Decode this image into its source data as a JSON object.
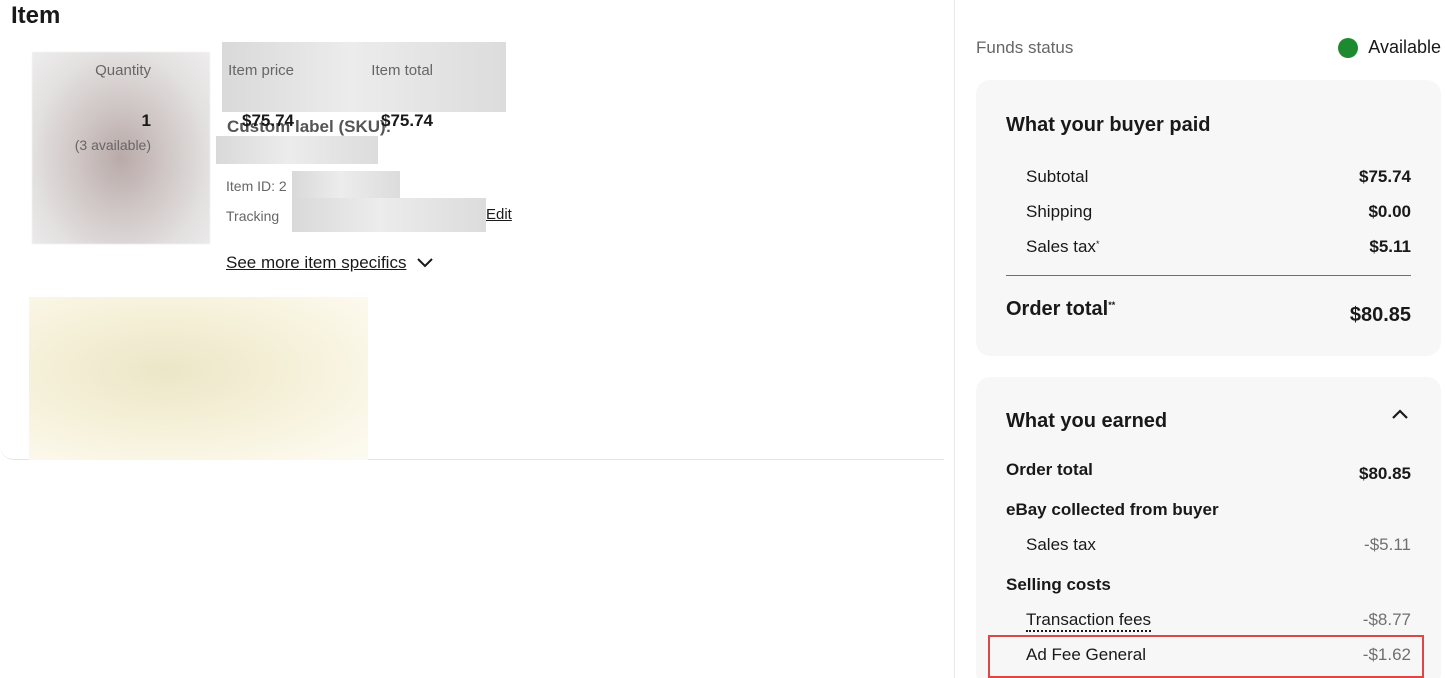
{
  "item": {
    "section_title": "Item",
    "sku_label": "Custom label (SKU):",
    "item_id_label": "Item ID: 2",
    "tracking_label": "Tracking",
    "edit_label": "Edit",
    "see_more_label": "See more item specifics",
    "columns": {
      "quantity_header": "Quantity",
      "price_header": "Item price",
      "total_header": "Item total",
      "quantity": "1",
      "available": "(3 available)",
      "price": "$75.74",
      "total": "$75.74"
    }
  },
  "funds": {
    "label": "Funds status",
    "status": "Available",
    "status_color": "#1e8a2f"
  },
  "buyer_paid": {
    "title": "What your buyer paid",
    "rows": [
      {
        "label": "Subtotal",
        "value": "$75.74"
      },
      {
        "label": "Shipping",
        "value": "$0.00"
      },
      {
        "label": "Sales tax",
        "value": "$5.11"
      }
    ],
    "sales_tax_mark": "*",
    "order_total_label": "Order total",
    "order_total_mark": "**",
    "order_total_value": "$80.85"
  },
  "earned": {
    "title": "What you earned",
    "order_total_label": "Order total",
    "order_total_value": "$80.85",
    "collected_label": "eBay collected from buyer",
    "sales_tax_label": "Sales tax",
    "sales_tax_value": "-$5.11",
    "selling_costs_label": "Selling costs",
    "transaction_fees_label": "Transaction fees",
    "transaction_fees_value": "-$8.77",
    "ad_fee_label": "Ad Fee General",
    "ad_fee_value": "-$1.62"
  },
  "colors": {
    "highlight": "#e04646",
    "panel_bg": "#f7f7f7"
  }
}
